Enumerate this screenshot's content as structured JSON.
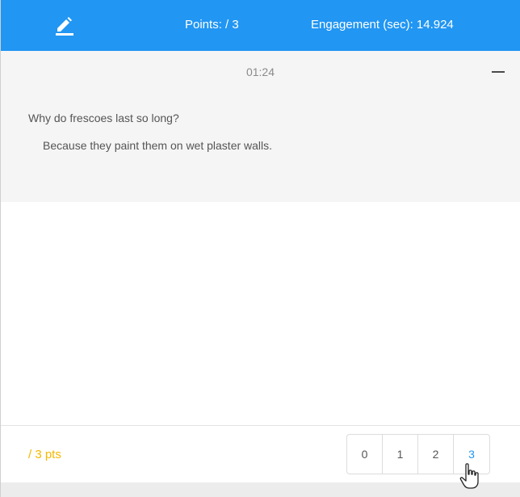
{
  "header": {
    "edit_icon": "pencil-icon",
    "points_label": "Points: / 3",
    "engagement_label": "Engagement (sec): 14.924"
  },
  "card": {
    "timer": "01:24",
    "collapse_icon": "minus-icon",
    "question": "Why do frescoes last so long?",
    "answer": "Because they paint them on wet plaster walls."
  },
  "footer": {
    "points_text": "/ 3 pts",
    "score_options": [
      "0",
      "1",
      "2",
      "3"
    ],
    "selected_score": "3"
  },
  "colors": {
    "header_bg": "#2196f3",
    "card_bg": "#f5f5f5",
    "points_accent": "#f5b800",
    "selected_score": "#2196f3"
  }
}
